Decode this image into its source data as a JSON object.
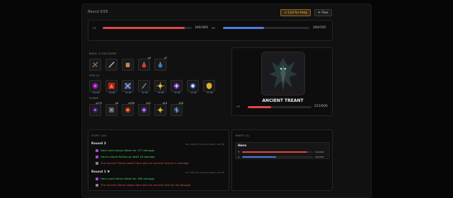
{
  "round_label": "Round 3/55",
  "buttons": {
    "help": "⚠ Call for Help",
    "flee": "✈ Flee"
  },
  "hero_bar": {
    "label": "HP",
    "value": "340/369",
    "fill": 0.921,
    "color": "#e04646"
  },
  "mp_bar": {
    "label": "MP",
    "value": "284/595",
    "fill": 0.477,
    "color": "#4f7be0"
  },
  "sections": {
    "basic": "BASIC & RECOVERY",
    "spells": "SPELLS",
    "runes": "RUNES",
    "log": "FIGHT LOG",
    "party": "PARTY (1)"
  },
  "basic_slots": [
    {
      "icon": "crossbow-icon",
      "badge": ""
    },
    {
      "icon": "sword-icon",
      "badge": ""
    },
    {
      "icon": "fist-icon",
      "badge": ""
    },
    {
      "icon": "health-potion-icon",
      "badge": "x4"
    },
    {
      "icon": "mana-potion-icon",
      "badge": "x7"
    }
  ],
  "spell_slots": [
    {
      "icon": "inferno-wave-icon",
      "cost": "120 MP"
    },
    {
      "icon": "fireball-icon",
      "cost": "80 MP"
    },
    {
      "icon": "frost-shard-icon",
      "cost": "60 MP"
    },
    {
      "icon": "shadow-bolt-icon",
      "cost": "40 MP"
    },
    {
      "icon": "holy-burst-icon",
      "cost": "95 MP"
    },
    {
      "icon": "arcane-star-icon",
      "cost": "55 MP"
    },
    {
      "icon": "frost-ring-icon",
      "cost": "50 MP"
    },
    {
      "icon": "golden-shield-icon",
      "cost": "65 MP"
    }
  ],
  "rune_slots": [
    {
      "icon": "void-rune-icon",
      "badge": "x175"
    },
    {
      "icon": "stone-rune-icon",
      "badge": "x9"
    },
    {
      "icon": "fire-rune-icon",
      "badge": "x190"
    },
    {
      "icon": "arcane-rune-icon",
      "badge": "x12"
    },
    {
      "icon": "sun-rune-icon",
      "badge": "x19"
    },
    {
      "icon": "frost-rune-icon",
      "badge": "x50"
    }
  ],
  "enemy": {
    "name": "ANCIENT TREANT",
    "hp_label": "HP",
    "hp_value": "221/600",
    "fill": 0.368,
    "color": "#e04646"
  },
  "log": {
    "rounds": [
      {
        "title": "Round 2",
        "meta": "You: 340 HP | Ancient Treant: 221 HP",
        "lines": [
          {
            "text": "Hero cast Inferno Wave for 177 damage",
            "color": "#4fd66a",
            "icon_color": "#a24fd6"
          },
          {
            "text": "Hero's sword follow-up dealt 16 damage",
            "color": "#4fd66a",
            "icon_color": "#a24fd6"
          },
          {
            "text": "The Ancient Treant swats Hero with an ancient limb for 1 damage",
            "color": "#e05050",
            "icon_color": "#888888"
          }
        ]
      },
      {
        "title": "Round 1 ▼",
        "meta": "You: 341 HP | Ancient Treant: 414 HP",
        "lines": [
          {
            "text": "Hero cast Inferno Wave for 186 damage",
            "color": "#4fd66a",
            "icon_color": "#a24fd6"
          },
          {
            "text": "The Ancient Treant swats Hero with an ancient limb for 28 damage",
            "color": "#e05050",
            "icon_color": "#888888"
          }
        ]
      }
    ]
  },
  "party": {
    "members": [
      {
        "name": "Hero",
        "hp": "340/369",
        "hp_fill": 0.921,
        "mp": "284/595",
        "mp_fill": 0.477
      }
    ]
  }
}
